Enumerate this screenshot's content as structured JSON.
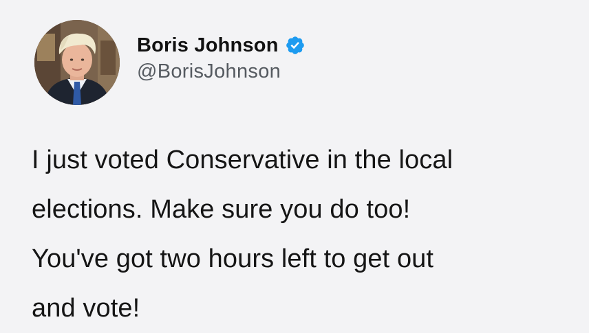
{
  "author": {
    "display_name": "Boris Johnson",
    "handle": "@BorisJohnson",
    "verified": true,
    "verified_color": "#1d9bf0",
    "avatar_icon": "profile-photo"
  },
  "tweet": {
    "lines": [
      "I just voted Conservative in the local",
      "elections. Make sure you do too!",
      "You've got two hours left to get out",
      "and vote!"
    ]
  },
  "colors": {
    "background": "#f3f3f5",
    "text": "#151515",
    "handle": "#555a60"
  }
}
